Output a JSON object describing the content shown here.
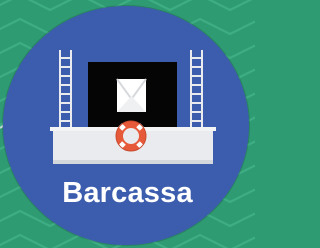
{
  "badge": {
    "label": "Barcassa",
    "icon": "barge-with-lifebuoy-icon"
  },
  "colors": {
    "background_green": "#2f9b72",
    "stripe_green": "#3fae84",
    "badge_blue": "#3c5dae",
    "deck_gray": "#e9ebee",
    "screen_black": "#050505",
    "lifebuoy_orange": "#e65a3a",
    "text_white": "#ffffff"
  }
}
